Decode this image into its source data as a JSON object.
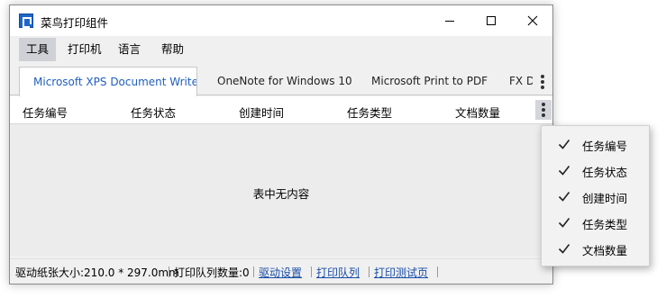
{
  "window": {
    "title": "菜鸟打印组件"
  },
  "menu": [
    "工具",
    "打印机",
    "语言",
    "帮助"
  ],
  "tabs": [
    "Microsoft XPS Document Writer",
    "OneNote for Windows 10",
    "Microsoft Print to PDF",
    "FX D"
  ],
  "columns": [
    "任务编号",
    "任务状态",
    "创建时间",
    "任务类型",
    "文档数量"
  ],
  "table": {
    "empty_text": "表中无内容"
  },
  "status": {
    "paper_size": "驱动纸张大小:210.0 * 297.0mm",
    "queue_count": "打印队列数量:0",
    "links": [
      "驱动设置",
      "打印队列",
      "打印测试页"
    ]
  },
  "column_menu": {
    "items": [
      {
        "label": "任务编号",
        "checked": true
      },
      {
        "label": "任务状态",
        "checked": true
      },
      {
        "label": "创建时间",
        "checked": true
      },
      {
        "label": "任务类型",
        "checked": true
      },
      {
        "label": "文档数量",
        "checked": true
      }
    ]
  },
  "colors": {
    "accent": "#1f5fbf",
    "link": "#1a4ea8",
    "menu_active": "#cfd1d6"
  },
  "icons": [
    "app-logo-icon",
    "minimize-icon",
    "maximize-icon",
    "close-icon",
    "more-vertical-icon",
    "checkmark-icon"
  ]
}
